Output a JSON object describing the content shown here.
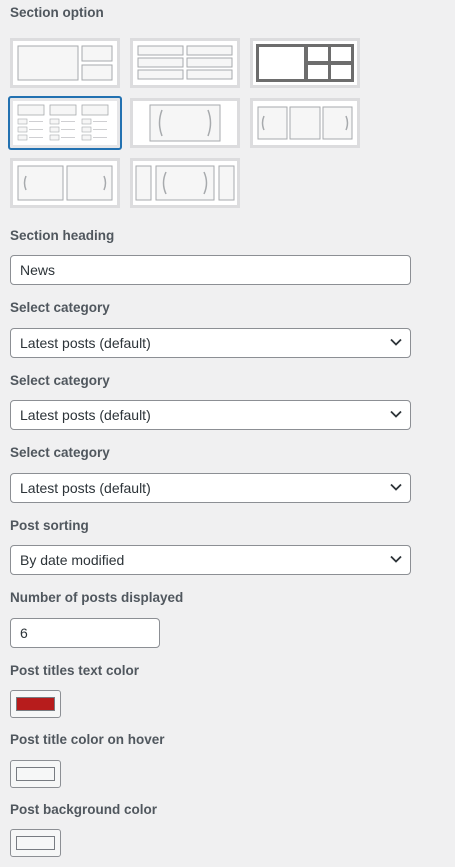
{
  "section_option": {
    "label": "Section option",
    "options": [
      {
        "name": "big-left-two-right"
      },
      {
        "name": "two-columns-list"
      },
      {
        "name": "big-left-grid-right"
      },
      {
        "name": "three-columns-lists",
        "selected": true
      },
      {
        "name": "slider-one"
      },
      {
        "name": "slider-three"
      },
      {
        "name": "slider-two"
      },
      {
        "name": "slider-centered"
      }
    ]
  },
  "section_heading": {
    "label": "Section heading",
    "value": "News"
  },
  "category_1": {
    "label": "Select category",
    "value": "Latest posts (default)"
  },
  "category_2": {
    "label": "Select category",
    "value": "Latest posts (default)"
  },
  "category_3": {
    "label": "Select category",
    "value": "Latest posts (default)"
  },
  "post_sorting": {
    "label": "Post sorting",
    "value": "By date modified"
  },
  "posts_displayed": {
    "label": "Number of posts displayed",
    "value": "6"
  },
  "title_color": {
    "label": "Post titles text color",
    "color": "#b71c1c"
  },
  "title_hover_color": {
    "label": "Post title color on hover",
    "color": "#f6f7f7"
  },
  "background_color": {
    "label": "Post background color",
    "color": "#f6f7f7"
  },
  "icons": {
    "select_arrow": "chevron-down-icon"
  }
}
